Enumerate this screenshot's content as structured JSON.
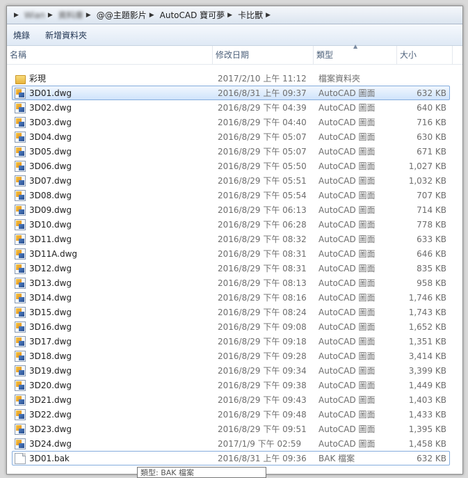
{
  "breadcrumb": [
    {
      "label": "Wian",
      "blurred": true
    },
    {
      "label": "資料庫",
      "blurred": true
    },
    {
      "label": "@@主題影片",
      "blurred": false
    },
    {
      "label": "AutoCAD 寶可夢",
      "blurred": false
    },
    {
      "label": "卡比獸",
      "blurred": false
    }
  ],
  "toolbar": {
    "burn_label": "燒錄",
    "new_folder_label": "新增資料夾"
  },
  "columns": {
    "name": "名稱",
    "date": "修改日期",
    "type": "類型",
    "size": "大小"
  },
  "files": [
    {
      "name": "彩現",
      "date": "2017/2/10 上午 11:12",
      "type": "檔案資料夾",
      "size": "",
      "icon": "folder-icon"
    },
    {
      "name": "3D01.dwg",
      "date": "2016/8/31 上午 09:37",
      "type": "AutoCAD 圖面",
      "size": "632 KB",
      "icon": "dwg-file-icon",
      "selected": true
    },
    {
      "name": "3D02.dwg",
      "date": "2016/8/29 下午 04:39",
      "type": "AutoCAD 圖面",
      "size": "640 KB",
      "icon": "dwg-file-icon"
    },
    {
      "name": "3D03.dwg",
      "date": "2016/8/29 下午 04:40",
      "type": "AutoCAD 圖面",
      "size": "716 KB",
      "icon": "dwg-file-icon"
    },
    {
      "name": "3D04.dwg",
      "date": "2016/8/29 下午 05:07",
      "type": "AutoCAD 圖面",
      "size": "630 KB",
      "icon": "dwg-file-icon"
    },
    {
      "name": "3D05.dwg",
      "date": "2016/8/29 下午 05:07",
      "type": "AutoCAD 圖面",
      "size": "671 KB",
      "icon": "dwg-file-icon"
    },
    {
      "name": "3D06.dwg",
      "date": "2016/8/29 下午 05:50",
      "type": "AutoCAD 圖面",
      "size": "1,027 KB",
      "icon": "dwg-file-icon"
    },
    {
      "name": "3D07.dwg",
      "date": "2016/8/29 下午 05:51",
      "type": "AutoCAD 圖面",
      "size": "1,032 KB",
      "icon": "dwg-file-icon"
    },
    {
      "name": "3D08.dwg",
      "date": "2016/8/29 下午 05:54",
      "type": "AutoCAD 圖面",
      "size": "707 KB",
      "icon": "dwg-file-icon"
    },
    {
      "name": "3D09.dwg",
      "date": "2016/8/29 下午 06:13",
      "type": "AutoCAD 圖面",
      "size": "714 KB",
      "icon": "dwg-file-icon"
    },
    {
      "name": "3D10.dwg",
      "date": "2016/8/29 下午 06:28",
      "type": "AutoCAD 圖面",
      "size": "778 KB",
      "icon": "dwg-file-icon"
    },
    {
      "name": "3D11.dwg",
      "date": "2016/8/29 下午 08:32",
      "type": "AutoCAD 圖面",
      "size": "633 KB",
      "icon": "dwg-file-icon"
    },
    {
      "name": "3D11A.dwg",
      "date": "2016/8/29 下午 08:31",
      "type": "AutoCAD 圖面",
      "size": "646 KB",
      "icon": "dwg-file-icon"
    },
    {
      "name": "3D12.dwg",
      "date": "2016/8/29 下午 08:31",
      "type": "AutoCAD 圖面",
      "size": "835 KB",
      "icon": "dwg-file-icon"
    },
    {
      "name": "3D13.dwg",
      "date": "2016/8/29 下午 08:13",
      "type": "AutoCAD 圖面",
      "size": "958 KB",
      "icon": "dwg-file-icon"
    },
    {
      "name": "3D14.dwg",
      "date": "2016/8/29 下午 08:16",
      "type": "AutoCAD 圖面",
      "size": "1,746 KB",
      "icon": "dwg-file-icon"
    },
    {
      "name": "3D15.dwg",
      "date": "2016/8/29 下午 08:24",
      "type": "AutoCAD 圖面",
      "size": "1,743 KB",
      "icon": "dwg-file-icon"
    },
    {
      "name": "3D16.dwg",
      "date": "2016/8/29 下午 09:08",
      "type": "AutoCAD 圖面",
      "size": "1,652 KB",
      "icon": "dwg-file-icon"
    },
    {
      "name": "3D17.dwg",
      "date": "2016/8/29 下午 09:18",
      "type": "AutoCAD 圖面",
      "size": "1,351 KB",
      "icon": "dwg-file-icon"
    },
    {
      "name": "3D18.dwg",
      "date": "2016/8/29 下午 09:28",
      "type": "AutoCAD 圖面",
      "size": "3,414 KB",
      "icon": "dwg-file-icon"
    },
    {
      "name": "3D19.dwg",
      "date": "2016/8/29 下午 09:34",
      "type": "AutoCAD 圖面",
      "size": "3,399 KB",
      "icon": "dwg-file-icon"
    },
    {
      "name": "3D20.dwg",
      "date": "2016/8/29 下午 09:38",
      "type": "AutoCAD 圖面",
      "size": "1,449 KB",
      "icon": "dwg-file-icon"
    },
    {
      "name": "3D21.dwg",
      "date": "2016/8/29 下午 09:43",
      "type": "AutoCAD 圖面",
      "size": "1,403 KB",
      "icon": "dwg-file-icon"
    },
    {
      "name": "3D22.dwg",
      "date": "2016/8/29 下午 09:48",
      "type": "AutoCAD 圖面",
      "size": "1,433 KB",
      "icon": "dwg-file-icon"
    },
    {
      "name": "3D23.dwg",
      "date": "2016/8/29 下午 09:51",
      "type": "AutoCAD 圖面",
      "size": "1,395 KB",
      "icon": "dwg-file-icon"
    },
    {
      "name": "3D24.dwg",
      "date": "2017/1/9 下午 02:59",
      "type": "AutoCAD 圖面",
      "size": "1,458 KB",
      "icon": "dwg-file-icon"
    },
    {
      "name": "3D01.bak",
      "date": "2016/8/31 上午 09:36",
      "type": "BAK 檔案",
      "size": "632 KB",
      "icon": "bak-file-icon",
      "outlined": true
    }
  ],
  "tooltip": "類型: BAK 檔案",
  "colors": {
    "selection_border": "#84acdd",
    "selection_fill": "#cfe3fb",
    "secondary_text": "#6d6d6d",
    "header_text": "#4c607a"
  }
}
